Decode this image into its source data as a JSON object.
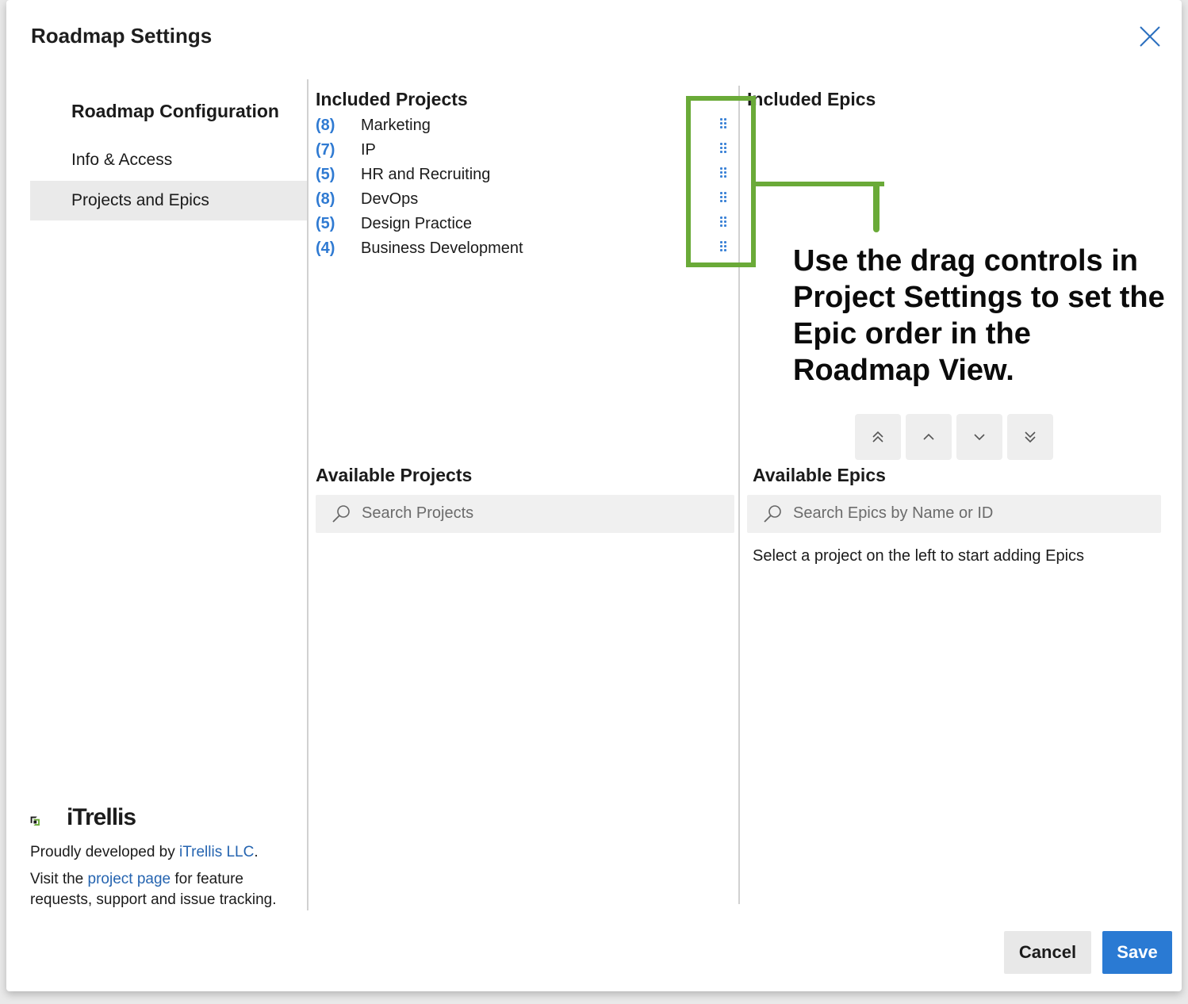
{
  "dialog": {
    "title": "Roadmap Settings"
  },
  "nav": {
    "heading": "Roadmap Configuration",
    "items": [
      {
        "label": "Info & Access",
        "selected": false
      },
      {
        "label": "Projects and Epics",
        "selected": true
      }
    ]
  },
  "included_projects": {
    "title": "Included Projects",
    "items": [
      {
        "count": "(8)",
        "name": "Marketing"
      },
      {
        "count": "(7)",
        "name": "IP"
      },
      {
        "count": "(5)",
        "name": "HR and Recruiting"
      },
      {
        "count": "(8)",
        "name": "DevOps"
      },
      {
        "count": "(5)",
        "name": "Design Practice"
      },
      {
        "count": "(4)",
        "name": "Business Development"
      }
    ]
  },
  "included_epics": {
    "title": "Included Epics"
  },
  "annotation": {
    "text": "Use the drag controls in Project Settings to set the Epic order in the Roadmap View.",
    "color": "#6aaa38"
  },
  "move_buttons": [
    "move-to-top-icon",
    "move-up-icon",
    "move-down-icon",
    "move-to-bottom-icon"
  ],
  "available_projects": {
    "title": "Available Projects",
    "search_placeholder": "Search Projects"
  },
  "available_epics": {
    "title": "Available Epics",
    "search_placeholder": "Search Epics by Name or ID",
    "hint": "Select a project on the left to start adding Epics"
  },
  "branding": {
    "logo_text": "iTrellis",
    "line1_prefix": "Proudly developed by ",
    "line1_link": "iTrellis LLC",
    "line1_suffix": ".",
    "line2_prefix": "Visit the ",
    "line2_link": "project page",
    "line2_suffix": " for feature requests, support and issue tracking."
  },
  "actions": {
    "cancel": "Cancel",
    "save": "Save"
  },
  "colors": {
    "accent": "#2a7ad3",
    "count": "#2f7ad2",
    "link": "#2564b0"
  }
}
